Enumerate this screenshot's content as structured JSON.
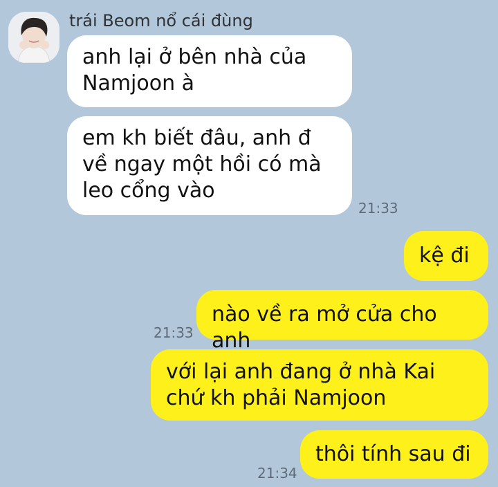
{
  "chat": {
    "sender_name": "trái Beom nổ cái đùng",
    "accent_colors": {
      "background": "#b2c7da",
      "incoming": "#ffffff",
      "outgoing": "#fef01b"
    },
    "messages": [
      {
        "direction": "incoming",
        "text": "anh lại ở bên nhà của Namjoon à"
      },
      {
        "direction": "incoming",
        "text": "em kh biết đâu, anh đ về ngay một hồi có mà leo cổng vào",
        "time": "21:33"
      },
      {
        "direction": "outgoing",
        "text": "kệ đi"
      },
      {
        "direction": "outgoing",
        "text": "nào về ra mở cửa cho anh",
        "time": "21:33"
      },
      {
        "direction": "outgoing",
        "text": "với lại anh đang ở nhà Kai chứ kh phải Namjoon"
      },
      {
        "direction": "outgoing",
        "text": "thôi tính sau đi",
        "time": "21:34"
      }
    ]
  }
}
